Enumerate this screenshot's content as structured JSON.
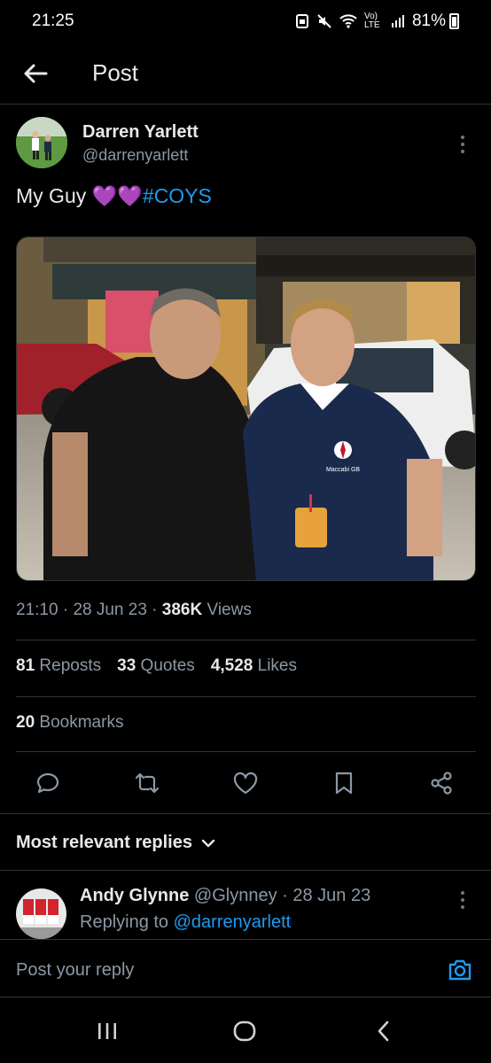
{
  "status_bar": {
    "time": "21:25",
    "network": "Vo) LTE",
    "battery": "81%"
  },
  "header": {
    "title": "Post"
  },
  "post": {
    "author_name": "Darren Yarlett",
    "author_handle": "@darrenyarlett",
    "text_prefix": "My Guy ",
    "emoji": "💜💜",
    "hashtag": "#COYS",
    "time": "21:10",
    "date": "28 Jun 23",
    "views_count": "386K",
    "views_label": "Views",
    "reposts_count": "81",
    "reposts_label": "Reposts",
    "quotes_count": "33",
    "quotes_label": "Quotes",
    "likes_count": "4,528",
    "likes_label": "Likes",
    "bookmarks_count": "20",
    "bookmarks_label": "Bookmarks",
    "photo_shirt_text": "Maccabi GB"
  },
  "replies": {
    "sort_label": "Most relevant replies",
    "items": [
      {
        "name": "Andy Glynne",
        "handle": "@Glynney",
        "date": "28 Jun 23",
        "replying_label": "Replying to",
        "replying_to": "@darrenyarlett"
      }
    ]
  },
  "composer": {
    "placeholder": "Post your reply"
  },
  "colors": {
    "accent": "#1d9bf0",
    "background": "#000000",
    "muted_text": "#8b98a5",
    "divider": "#2f3336",
    "heart_emoji": "#a56bf0"
  },
  "icons": {
    "back": "arrow-left-icon",
    "more": "more-vertical-icon",
    "reply": "reply-bubble-icon",
    "repost": "repost-icon",
    "like": "heart-icon",
    "bookmark": "bookmark-icon",
    "share": "share-icon",
    "camera": "camera-icon",
    "sort": "chevron-down-icon",
    "nav_recents": "recents-icon",
    "nav_home": "home-icon",
    "nav_back": "nav-back-icon"
  }
}
